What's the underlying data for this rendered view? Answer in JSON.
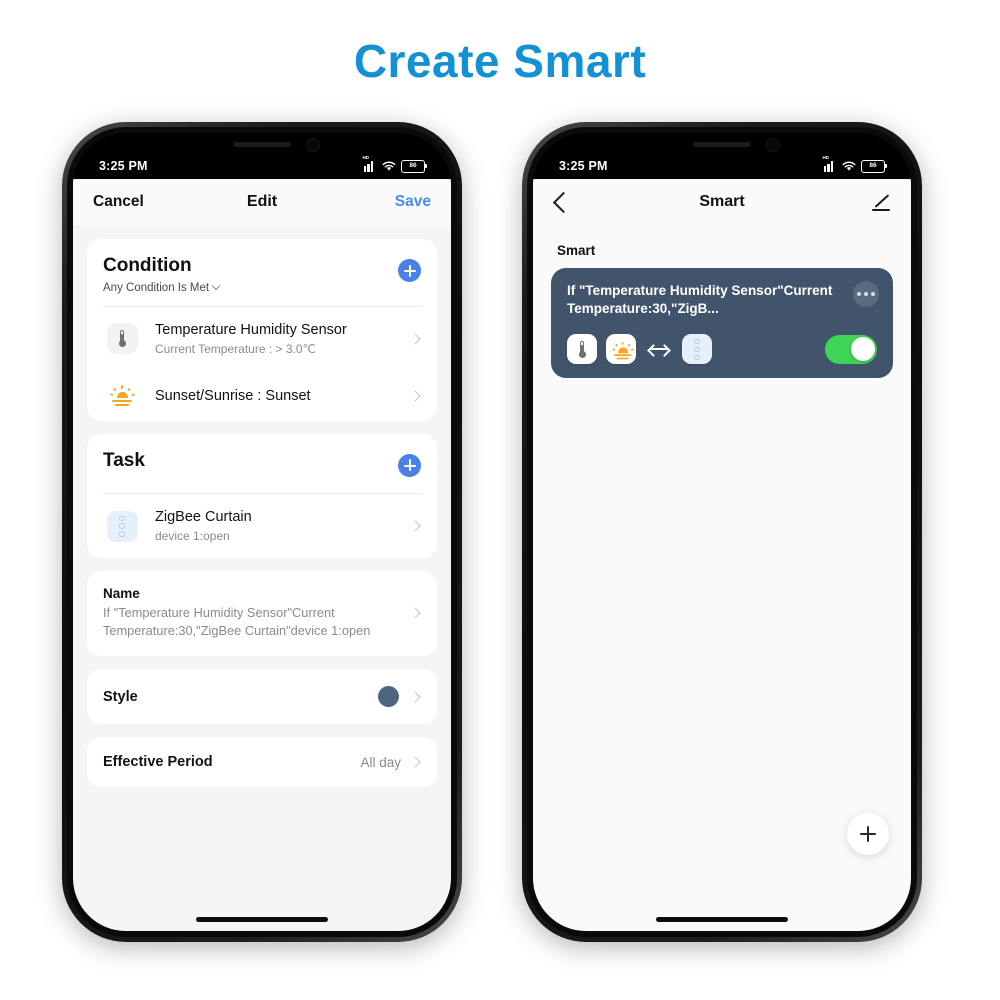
{
  "page": {
    "title": "Create Smart",
    "title_color": "#1490d4",
    "background": "#ffffff"
  },
  "status_bar": {
    "time": "3:25 PM",
    "signal_label": "HD",
    "signal_icon": "cellular-signal-icon",
    "wifi_icon": "wifi-icon",
    "battery_level": "86"
  },
  "left_phone": {
    "navbar": {
      "cancel_label": "Cancel",
      "title": "Edit",
      "save_label": "Save",
      "save_color": "#4a8bf0"
    },
    "condition_section": {
      "title": "Condition",
      "subtitle": "Any Condition Is Met",
      "add_button_color": "#4a80e8",
      "items": [
        {
          "icon": "thermometer-icon",
          "title": "Temperature Humidity Sensor",
          "subtitle": "Current Temperature : > 3.0℃"
        },
        {
          "icon": "sunset-icon",
          "title": "Sunset/Sunrise : Sunset",
          "subtitle": ""
        }
      ]
    },
    "task_section": {
      "title": "Task",
      "add_button_color": "#4a80e8",
      "items": [
        {
          "icon": "zigbee-curtain-icon",
          "title": "ZigBee Curtain",
          "subtitle": "device 1:open"
        }
      ]
    },
    "name_section": {
      "label": "Name",
      "value": "If \"Temperature Humidity Sensor\"Current Temperature:30,\"ZigBee Curtain\"device 1:open"
    },
    "style_section": {
      "label": "Style",
      "swatch_color": "#4b6580"
    },
    "effective_period_section": {
      "label": "Effective Period",
      "value": "All day"
    }
  },
  "right_phone": {
    "navbar": {
      "back_icon": "back-chevron-icon",
      "title": "Smart",
      "edit_icon": "pencil-edit-icon"
    },
    "section_label": "Smart",
    "smart_card": {
      "text": "If \"Temperature Humidity Sensor\"Current Temperature:30,\"ZigB...",
      "background": "#42546b",
      "menu_icon": "more-options-icon",
      "icons": [
        "thermometer-icon",
        "sunset-icon",
        "double-arrow-icon",
        "zigbee-curtain-icon"
      ],
      "toggle_state": "on",
      "toggle_color": "#3ed455"
    },
    "fab_icon": "add-plus-icon"
  }
}
